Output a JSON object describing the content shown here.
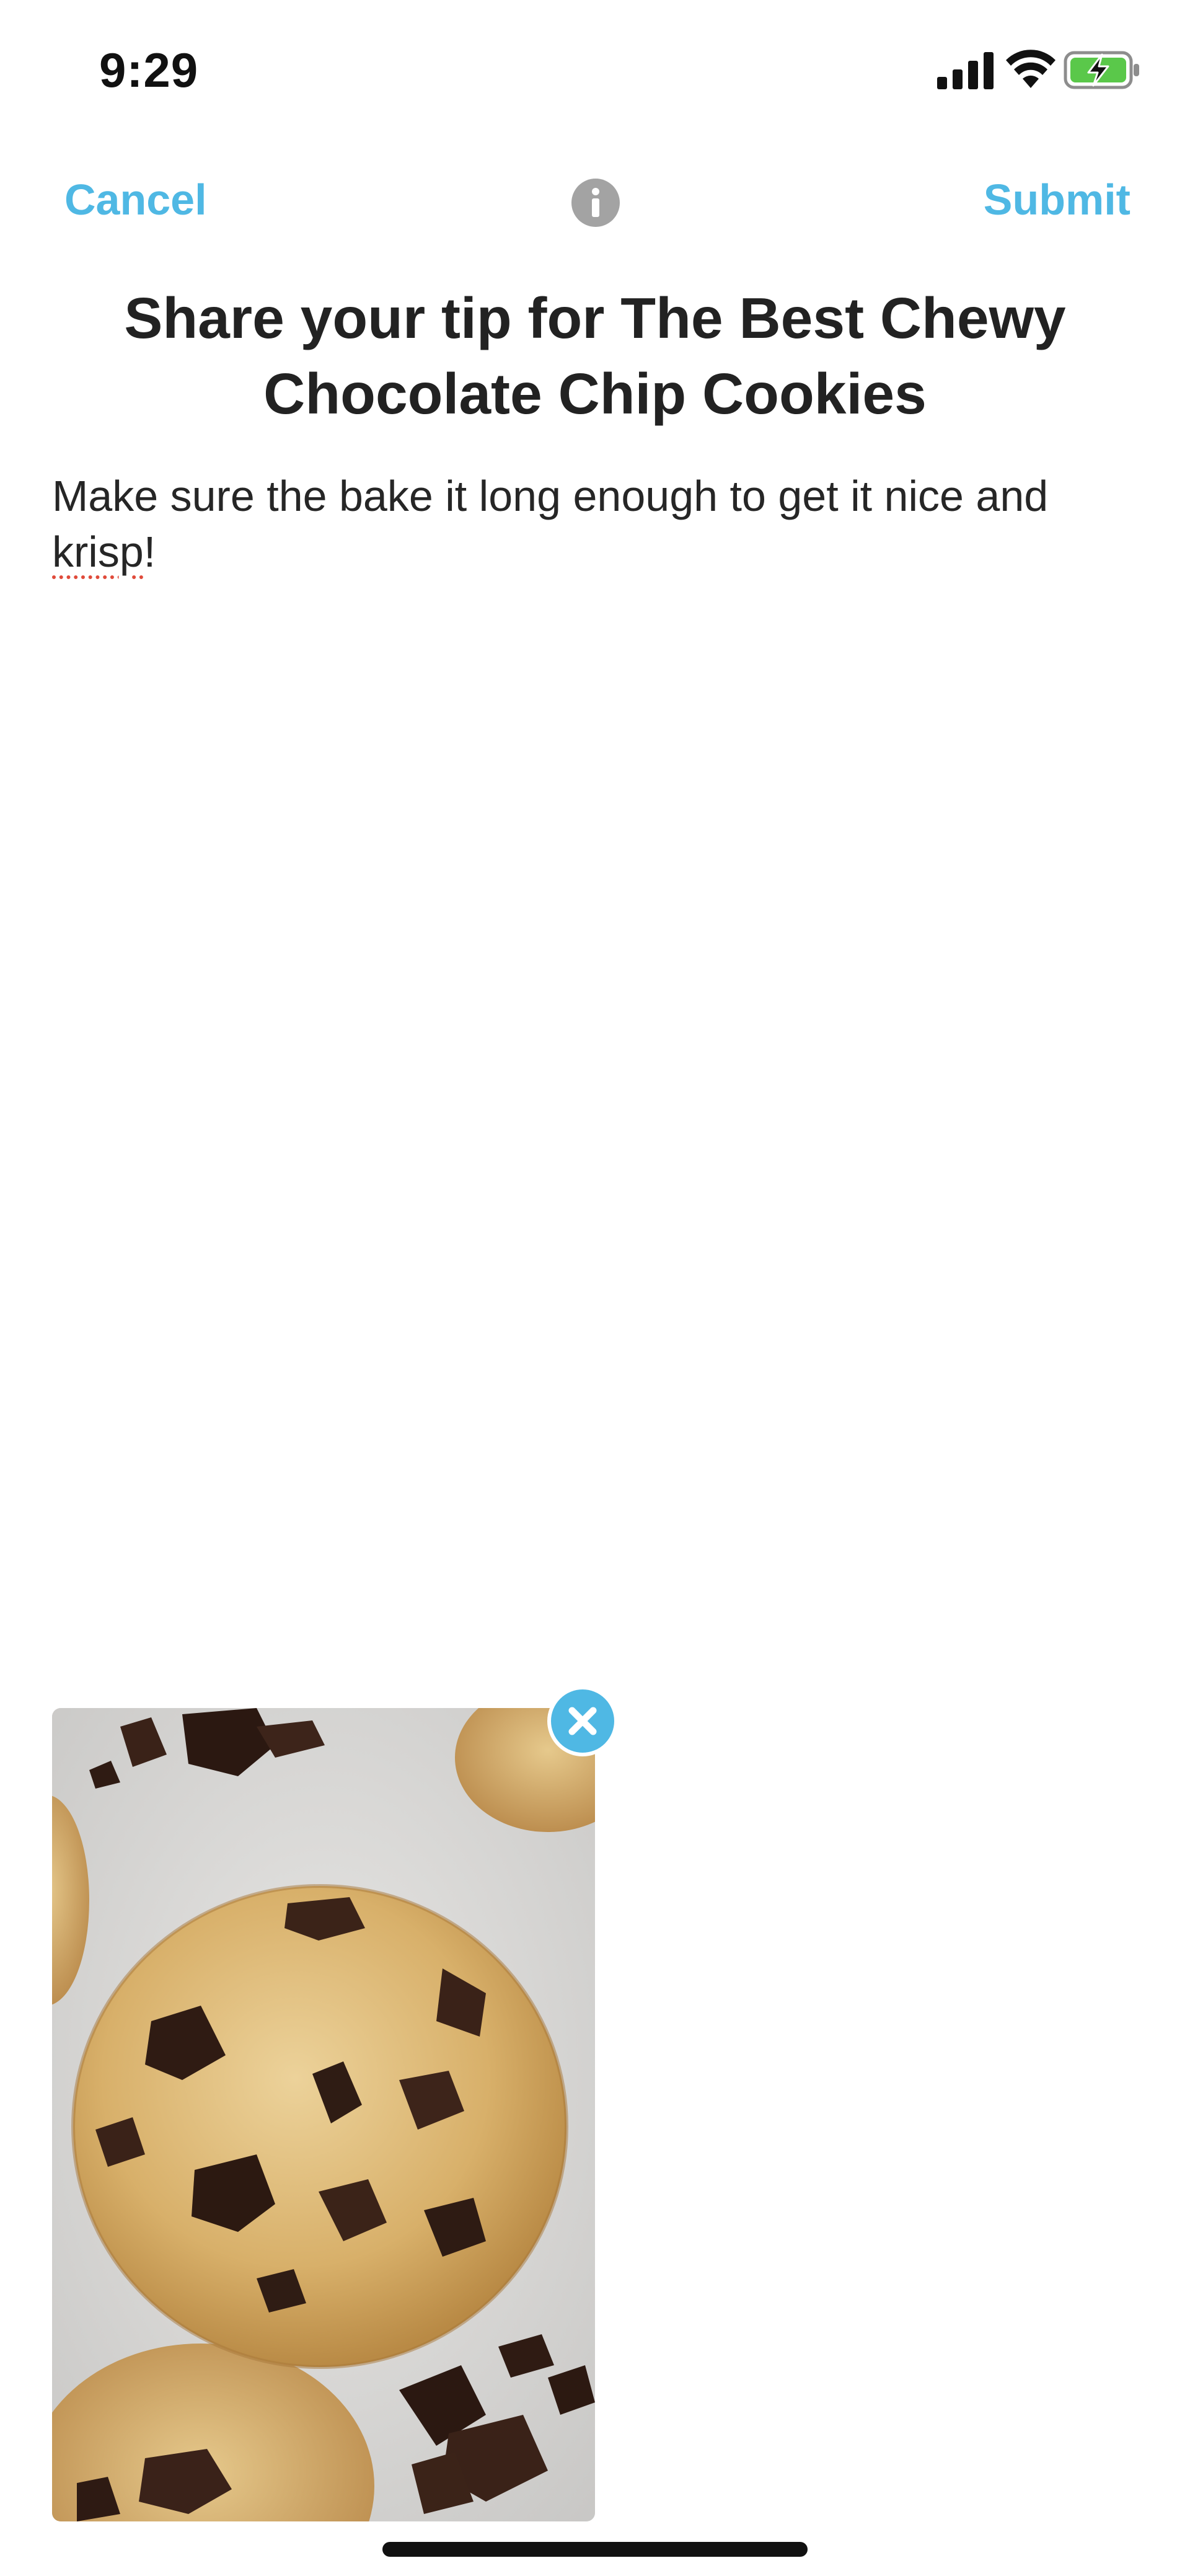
{
  "status_bar": {
    "time": "9:29",
    "icons": [
      "signal-icon",
      "wifi-icon",
      "battery-charging-icon"
    ]
  },
  "nav": {
    "cancel_label": "Cancel",
    "info_icon": "info-icon",
    "submit_label": "Submit"
  },
  "title": "Share your tip for The Best Chewy Chocolate Chip Cookies",
  "tip": {
    "text_before": "Make sure the bake it long enough to get it nice and ",
    "misspelled_word": "krisp",
    "text_after": "!"
  },
  "attachment": {
    "remove_icon": "close-icon"
  },
  "colors": {
    "accent": "#4fb8e4",
    "title_text": "#222222",
    "body_text": "#262626",
    "info_icon": "#a3a3a3",
    "spellcheck_underline": "#e04a3a"
  }
}
